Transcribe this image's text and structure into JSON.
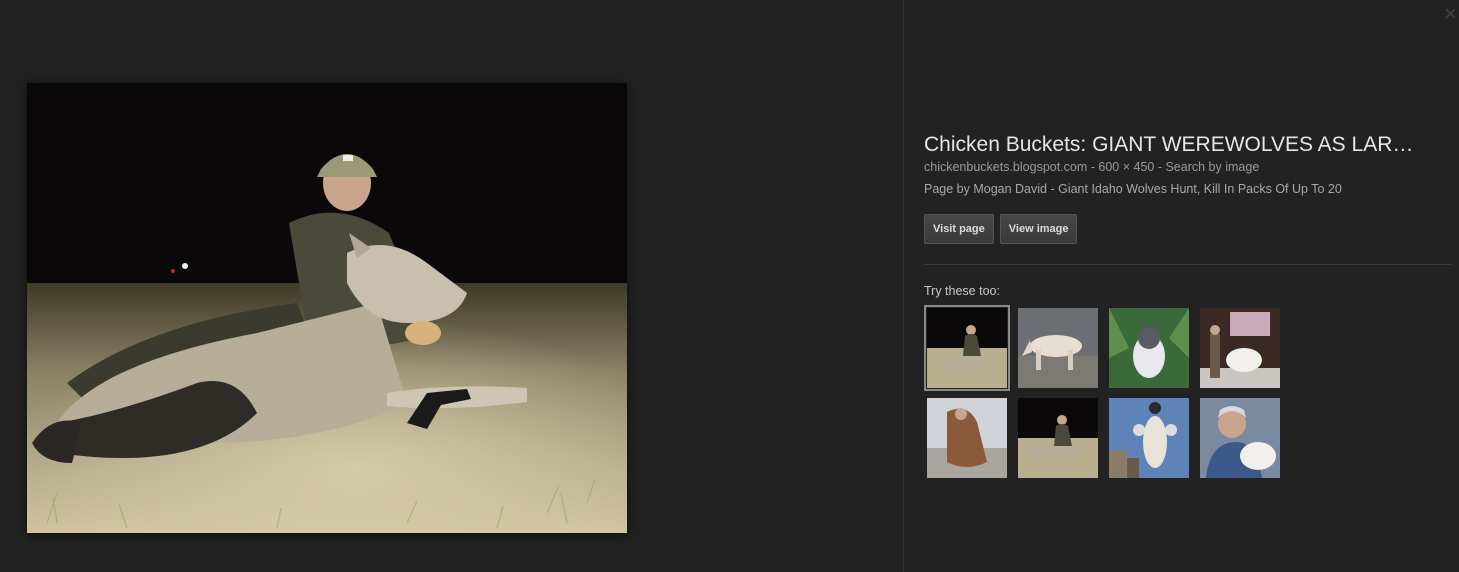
{
  "viewer": {
    "close_icon": "close-icon",
    "result": {
      "title": "Chicken Buckets: GIANT WEREWOLVES AS LAR…",
      "domain": "chickenbuckets.blogspot.com",
      "meta_sep": " - ",
      "dimensions": "600 × 450",
      "search_by_image": "Search by image",
      "description": "Page by Mogan David - Giant Idaho Wolves Hunt, Kill In Packs Of Up To 20",
      "visit_page_label": "Visit page",
      "view_image_label": "View image"
    },
    "related": {
      "label": "Try these too:",
      "thumbnail_count_rows": 2
    }
  },
  "colors": {
    "background": "#222222",
    "title_text": "#e6e6e6",
    "meta_text": "#9a9a9a",
    "button_bg": "#3f3f3f"
  }
}
